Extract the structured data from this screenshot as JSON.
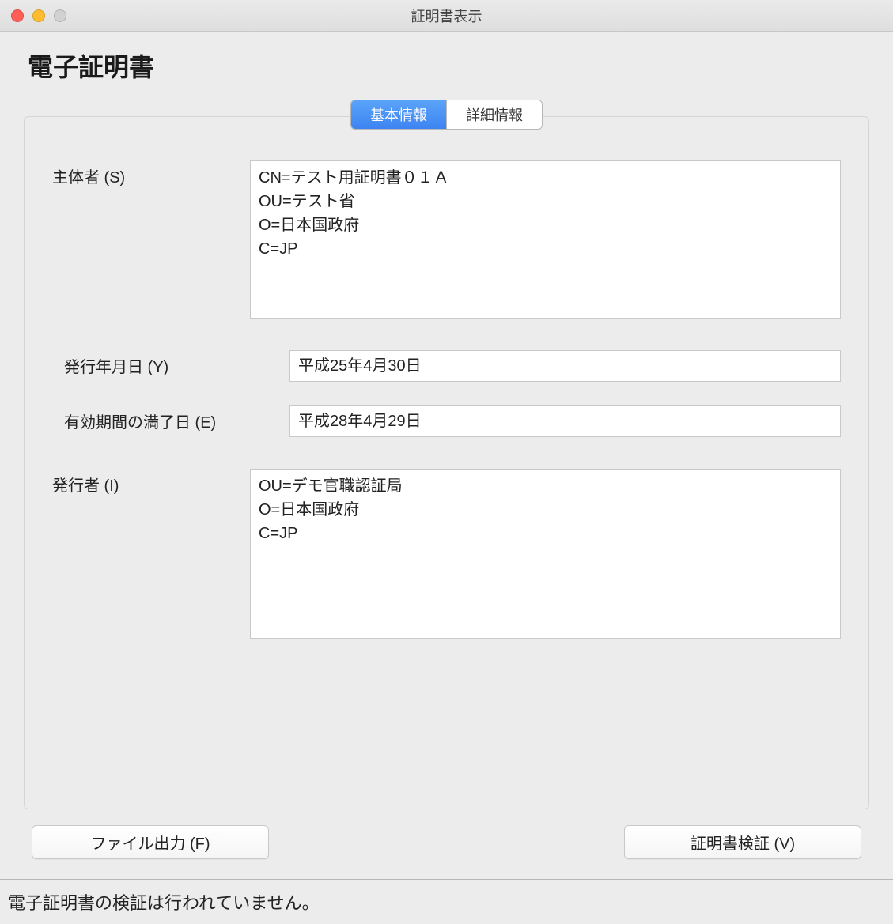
{
  "window": {
    "title": "証明書表示"
  },
  "heading": "電子証明書",
  "tabs": {
    "basic": "基本情報",
    "detail": "詳細情報"
  },
  "fields": {
    "subject": {
      "label": "主体者 (S)",
      "value": "CN=テスト用証明書０１Ａ\nOU=テスト省\nO=日本国政府\nC=JP"
    },
    "issueDate": {
      "label": "発行年月日 (Y)",
      "value": "平成25年4月30日"
    },
    "expiryDate": {
      "label": "有効期間の満了日 (E)",
      "value": "平成28年4月29日"
    },
    "issuer": {
      "label": "発行者 (I)",
      "value": "OU=デモ官職認証局\nO=日本国政府\nC=JP"
    }
  },
  "buttons": {
    "fileExport": "ファイル出力 (F)",
    "verify": "証明書検証 (V)"
  },
  "status": "電子証明書の検証は行われていません。"
}
